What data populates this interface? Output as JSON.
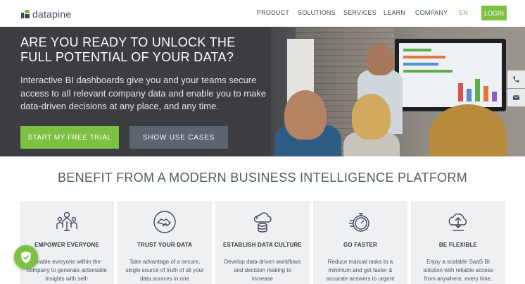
{
  "brand": {
    "name": "datapine"
  },
  "nav": {
    "items": [
      {
        "label": "PRODUCT"
      },
      {
        "label": "SOLUTIONS"
      },
      {
        "label": "SERVICES"
      },
      {
        "label": "LEARN"
      },
      {
        "label": "COMPANY"
      }
    ],
    "language": "EN",
    "login_label": "LOGIN"
  },
  "hero": {
    "title": "ARE YOU READY TO UNLOCK THE FULL POTENTIAL OF YOUR DATA?",
    "subtitle": "Interactive BI dashboards give you and your teams secure access to all relevant company data and enable you to make data-driven decisions at any place, and any time.",
    "primary_cta": "START MY FREE TRIAL",
    "secondary_cta": "SHOW USE CASES"
  },
  "side_buttons": [
    {
      "icon": "phone-icon"
    },
    {
      "icon": "mail-icon"
    }
  ],
  "benefits": {
    "title": "BENEFIT FROM A MODERN BUSINESS INTELLIGENCE PLATFORM",
    "cards": [
      {
        "icon": "people-icon",
        "title": "EMPOWER EVERYONE",
        "text": "Enable everyone within the company to generate actionable insights with self-"
      },
      {
        "icon": "handshake-icon",
        "title": "TRUST YOUR DATA",
        "text": "Take advantage of a secure, single source of truth of all your data sources in one"
      },
      {
        "icon": "cloud-database-icon",
        "title": "ESTABLISH DATA CULTURE",
        "text": "Develop data-driven workflows and decision making to increase"
      },
      {
        "icon": "stopwatch-icon",
        "title": "GO FASTER",
        "text": "Reduce manual tasks to a minimum and get faster & accurate answers to urgent"
      },
      {
        "icon": "cloud-network-icon",
        "title": "BE FLEXIBLE",
        "text": "Enjoy a scalable SaaS BI solution with reliable access from anywhere, every time,"
      }
    ]
  },
  "badge": {
    "icon": "shield-check-icon"
  },
  "colors": {
    "accent": "#7cc142",
    "dark": "#3e4a58",
    "hero_bg": "#3b3d40",
    "secondary_button": "#5b6470"
  }
}
